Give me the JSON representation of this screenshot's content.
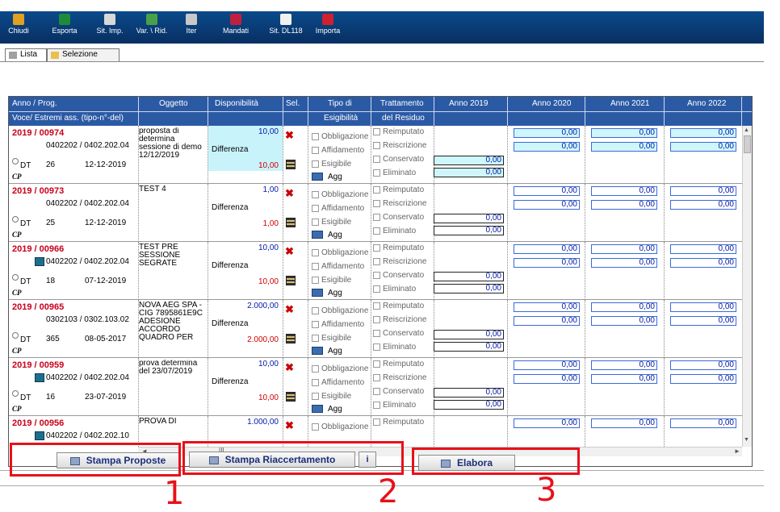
{
  "toolbar": {
    "buttons": [
      {
        "label": "Chiudi",
        "icon": "exit-icon",
        "color": "#e0a020"
      },
      {
        "label": "Esporta",
        "icon": "excel-icon",
        "color": "#1f8a3a"
      },
      {
        "label": "Sit. Imp.",
        "icon": "book-icon",
        "color": "#d8d8d8"
      },
      {
        "label": "Var. \\ Rid.",
        "icon": "pages-icon",
        "color": "#4aa04a"
      },
      {
        "label": "Iter",
        "icon": "flow-icon",
        "color": "#c8c8c8"
      },
      {
        "label": "Mandati",
        "icon": "mandate-icon",
        "color": "#c02040"
      },
      {
        "label": "Sit. DL118",
        "icon": "dollar-icon",
        "color": "#f0f0f0"
      },
      {
        "label": "Importa",
        "icon": "import-icon",
        "color": "#d02030"
      }
    ]
  },
  "tabs": [
    {
      "label": "Lista",
      "icon": "list-icon"
    },
    {
      "label": "Selezione",
      "icon": "filter-icon"
    }
  ],
  "table": {
    "headers": {
      "anno_prog": "Anno / Prog.",
      "voce": "Voce/ Estremi ass. (tipo-n°-del)",
      "oggetto": "Oggetto",
      "disponibilita": "Disponibilità",
      "sel": "Sel.",
      "tipo_di": "Tipo di",
      "esigibilita": "Esigibilità",
      "trattamento": "Trattamento",
      "del_residuo": "del Residuo",
      "anno2019": "Anno 2019",
      "anno2020": "Anno 2020",
      "anno2021": "Anno 2021",
      "anno2022": "Anno 2022"
    },
    "labels": {
      "differenza": "Differenza",
      "obbligazione": "Obbligazione",
      "affidamento": "Affidamento",
      "esigibile": "Esigibile",
      "agg": "Agg",
      "reimputato": "Reimputato",
      "reiscrizione": "Reiscrizione",
      "conservato": "Conservato",
      "eliminato": "Eliminato",
      "cp": "CP"
    },
    "rows": [
      {
        "anno": "2019 / 00974",
        "code": "0402202 / 0402.202.04",
        "tipo": "DT",
        "num": "26",
        "date": "12-12-2019",
        "oggetto": "proposta di determina sessione di demo 12/12/2019",
        "disp": "10,00",
        "diff": "10,00",
        "conservato": "0,00",
        "eliminato": "0,00",
        "a2020a": "0,00",
        "a2021a": "0,00",
        "a2022a": "0,00",
        "a2020b": "0,00",
        "a2021b": "0,00",
        "a2022b": "0,00",
        "highlight": true,
        "doc_icon": false
      },
      {
        "anno": "2019 / 00973",
        "code": "0402202 / 0402.202.04",
        "tipo": "DT",
        "num": "25",
        "date": "12-12-2019",
        "oggetto": "TEST 4",
        "disp": "1,00",
        "diff": "1,00",
        "conservato": "0,00",
        "eliminato": "0,00",
        "a2020a": "0,00",
        "a2021a": "0,00",
        "a2022a": "0,00",
        "a2020b": "0,00",
        "a2021b": "0,00",
        "a2022b": "0,00",
        "highlight": false,
        "doc_icon": false
      },
      {
        "anno": "2019 / 00966",
        "code": "0402202 / 0402.202.04",
        "tipo": "DT",
        "num": "18",
        "date": "07-12-2019",
        "oggetto": "TEST PRE SESSIONE SEGRATE",
        "disp": "10,00",
        "diff": "10,00",
        "conservato": "0,00",
        "eliminato": "0,00",
        "a2020a": "0,00",
        "a2021a": "0,00",
        "a2022a": "0,00",
        "a2020b": "0,00",
        "a2021b": "0,00",
        "a2022b": "0,00",
        "highlight": false,
        "doc_icon": true
      },
      {
        "anno": "2019 / 00965",
        "code": "0302103 / 0302.103.02",
        "tipo": "DT",
        "num": "365",
        "date": "08-05-2017",
        "oggetto": "NOVA AEG SPA - CIG 7895861E9C ADESIONE ACCORDO QUADRO PER",
        "disp": "2.000,00",
        "diff": "2.000,00",
        "conservato": "0,00",
        "eliminato": "0,00",
        "a2020a": "0,00",
        "a2021a": "0,00",
        "a2022a": "0,00",
        "a2020b": "0,00",
        "a2021b": "0,00",
        "a2022b": "0,00",
        "highlight": false,
        "doc_icon": false
      },
      {
        "anno": "2019 / 00959",
        "code": "0402202 / 0402.202.04",
        "tipo": "DT",
        "num": "16",
        "date": "23-07-2019",
        "oggetto": "prova determina del 23/07/2019",
        "disp": "10,00",
        "diff": "10,00",
        "conservato": "0,00",
        "eliminato": "0,00",
        "a2020a": "0,00",
        "a2021a": "0,00",
        "a2022a": "0,00",
        "a2020b": "0,00",
        "a2021b": "0,00",
        "a2022b": "0,00",
        "highlight": false,
        "doc_icon": true
      },
      {
        "anno": "2019 / 00956",
        "code": "0402202 / 0402.202.10",
        "tipo": "",
        "num": "",
        "date": "",
        "oggetto": "PROVA DI",
        "disp": "1.000,00",
        "diff": "",
        "conservato": "",
        "eliminato": "",
        "a2020a": "0,00",
        "a2021a": "0,00",
        "a2022a": "0,00",
        "a2020b": "",
        "a2021b": "",
        "a2022b": "",
        "highlight": false,
        "doc_icon": true
      }
    ]
  },
  "scroll": {
    "hscroll_mark": "III"
  },
  "buttons": {
    "stampa_proposte": "Stampa Proposte",
    "stampa_riaccertamento": "Stampa Riaccertamento",
    "info": "i",
    "elabora": "Elabora"
  },
  "annotations": {
    "one": "1",
    "two": "2",
    "three": "3"
  },
  "colors": {
    "header_bg": "#2b5aa5",
    "anno_red": "#c8001a",
    "value_blue": "#0018a8",
    "annotation_red": "#e8101a",
    "highlight_cyan": "#c9f3fb"
  }
}
